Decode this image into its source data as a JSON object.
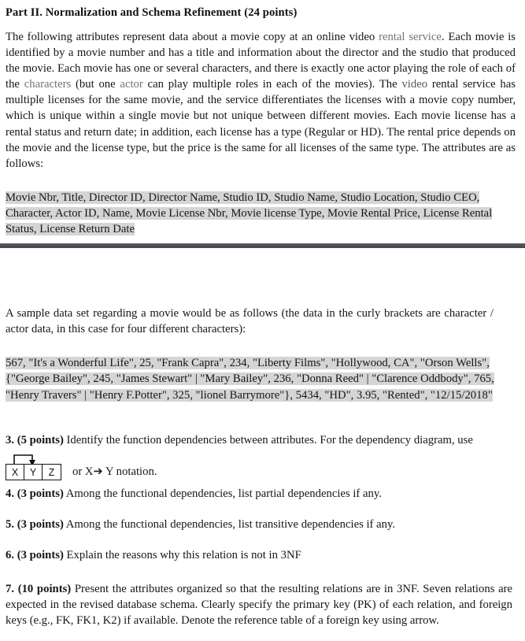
{
  "document": {
    "heading": "Part II.  Normalization and Schema Refinement (24 points)",
    "intro": {
      "s1": "The following attributes represent data about a movie copy at an online video ",
      "s2": "rental service",
      "s3": ". Each movie is identified by a movie number and has a title and information about the director and the studio that produced the movie. Each movie has one or several characters, and there is exactly one actor playing the role of each of the ",
      "s4": "characters",
      "s5": " (but one ",
      "s6": "actor",
      "s7": " can play multiple roles in each of the movies). The ",
      "s8": "video",
      "s9": " rental service has multiple licenses for the same movie, and the service differentiates the licenses with a movie copy number, which is unique within a single movie but not unique between different movies. Each movie license has a rental status and return date; in addition, each license has a type (Regular or HD). The rental price depends on the movie and the license type, but the price is the same for all licenses of the same type. The attributes are as follows:"
    },
    "attributes_block": "Movie Nbr, Title, Director ID, Director Name, Studio ID, Studio Name, Studio Location, Studio CEO, Character, Actor ID, Name, Movie License Nbr, Movie license Type, Movie Rental Price, License Rental Status, License Return Date",
    "sample_intro": "A sample data set regarding a movie would be as follows (the data in the curly brackets are character / actor data, in this case for four different characters):",
    "sample_data_block": "567, \"It's a Wonderful Life\", 25, \"Frank Capra\", 234, \"Liberty Films\", \"Hollywood, CA\", \"Orson Wells\", {\"George Bailey\", 245, \"James Stewart\" | \"Mary Bailey\", 236, \"Donna Reed\" | \"Clarence Oddbody\", 765, \"Henry Travers\" | \"Henry F.Potter\", 325, \"lionel Barrymore\"}, 5434, \"HD\", 3.95, \"Rented\", \"12/15/2018\""
  },
  "questions": [
    {
      "number": "3.",
      "points": "(5 points)",
      "text": " Identify the function dependencies between attributes.  For the dependency diagram, use"
    },
    {
      "number": "4.",
      "points": "(3 points)",
      "text": " Among the functional dependencies, list partial dependencies if any."
    },
    {
      "number": "5.",
      "points": "(3 points)",
      "text": " Among the functional dependencies, list transitive dependencies if any."
    },
    {
      "number": "6.",
      "points": "(3 points)",
      "text": " Explain the reasons why this relation is not in 3NF"
    },
    {
      "number": "7.",
      "points": "(10 points)",
      "text": " Present the attributes organized so that the resulting relations are in 3NF. Seven relations are expected in the revised database schema.  Clearly specify the primary key (PK) of each relation, and foreign keys (e.g., FK, FK1, K2) if available.  Denote the reference table of a foreign key using arrow."
    }
  ],
  "dependency_diagram": {
    "cells": [
      "X",
      "Y",
      "Z"
    ],
    "trailing_text": "or  X➔ Y notation."
  },
  "colors": {
    "highlight": "#d5d5d5",
    "divider": "#494e52",
    "text": "#15161a",
    "faded_text": "#6f7478"
  }
}
